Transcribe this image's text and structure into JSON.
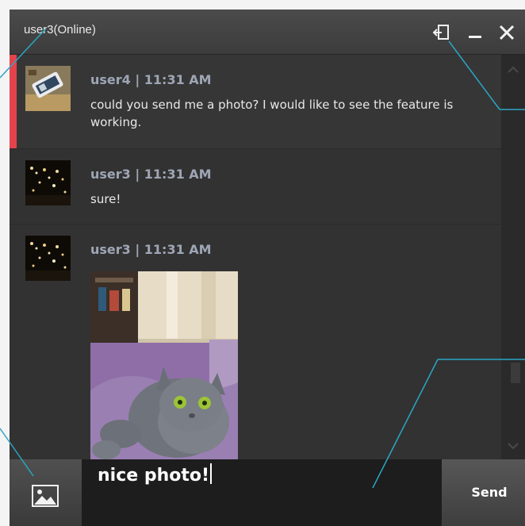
{
  "window": {
    "title": "user3(Online)",
    "controls": {
      "popout_icon": "popout-icon",
      "minimize_icon": "minimize-icon",
      "close_icon": "close-icon"
    }
  },
  "messages": [
    {
      "user": "user4",
      "time": "11:31 AM",
      "header": "user4 | 11:31 AM",
      "text": "could you send me a photo? I would like to see the feature is working.",
      "unread": true,
      "avatar": "user4-avatar-photo"
    },
    {
      "user": "user3",
      "time": "11:31 AM",
      "header": "user3 | 11:31 AM",
      "text": "sure!",
      "avatar": "user3-avatar-photo"
    },
    {
      "user": "user3",
      "time": "11:31 AM",
      "header": "user3 | 11:31 AM",
      "attachment": "cat-photo"
    }
  ],
  "composer": {
    "value": "nice photo!",
    "image_button_icon": "image-icon",
    "send_label": "Send"
  },
  "colors": {
    "window_bg": "#2f2f2f",
    "titlebar": "#444444",
    "unread_accent": "#e4434c",
    "header_text": "#9ea6b5",
    "annotation_line": "#2aa6c4"
  }
}
